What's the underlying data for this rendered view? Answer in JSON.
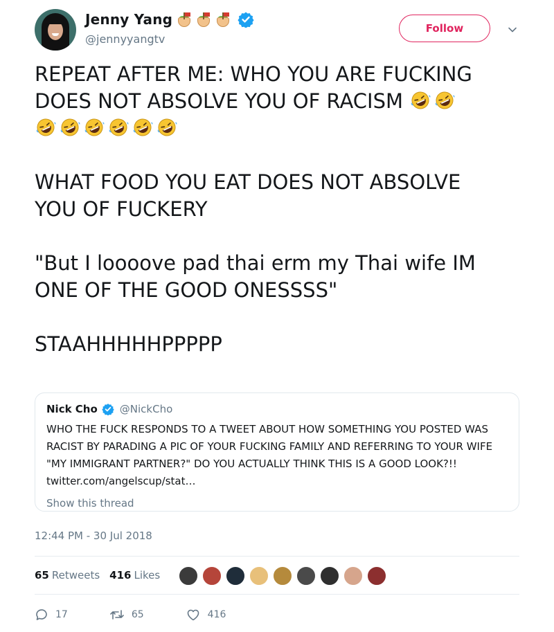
{
  "author": {
    "name": "Jenny Yang",
    "handle": "@jennyyangtv",
    "name_emojis": [
      "rice-bowl-flag-emoji",
      "rice-bowl-flag-emoji",
      "rice-bowl-flag-emoji"
    ],
    "verified": true
  },
  "follow_label": "Follow",
  "tweet": {
    "line1": "REPEAT AFTER ME: WHO YOU ARE FUCKING",
    "line2": "DOES NOT ABSOLVE YOU OF RACISM",
    "line2_emoji_count": 2,
    "line3_emoji_count": 6,
    "para2_line1": "WHAT FOOD YOU EAT DOES NOT ABSOLVE",
    "para2_line2": "YOU OF FUCKERY",
    "para3_line1": "\"But I loooove pad thai erm my Thai wife IM",
    "para3_line2": "ONE OF THE GOOD ONESSSS\"",
    "para4": "STAAHHHHHPPPPP"
  },
  "quote": {
    "name": "Nick Cho",
    "handle": "@NickCho",
    "verified": true,
    "text": "WHO THE FUCK RESPONDS TO A TWEET ABOUT HOW SOMETHING YOU POSTED WAS RACIST BY PARADING A PIC OF YOUR FUCKING FAMILY AND REFERRING TO YOUR WIFE \"MY IMMIGRANT PARTNER?\" DO YOU ACTUALLY THINK THIS IS A GOOD LOOK?!! ",
    "link": "twitter.com/angelscup/stat…",
    "show_thread": "Show this thread"
  },
  "timestamp": "12:44 PM - 30 Jul 2018",
  "stats": {
    "retweets_count": "65",
    "retweets_label": "Retweets",
    "likes_count": "416",
    "likes_label": "Likes"
  },
  "likers": [
    "#3b3b3b",
    "#b5453a",
    "#1f2d3a",
    "#e8c07a",
    "#b58a3c",
    "#4a4a4a",
    "#2f2f2f",
    "#d6a58c",
    "#8c2f2f"
  ],
  "actions": {
    "replies": "17",
    "retweets": "65",
    "likes": "416"
  },
  "colors": {
    "accent_follow": "#e0245e",
    "verified_blue": "#1da1f2",
    "muted_text": "#657786"
  }
}
